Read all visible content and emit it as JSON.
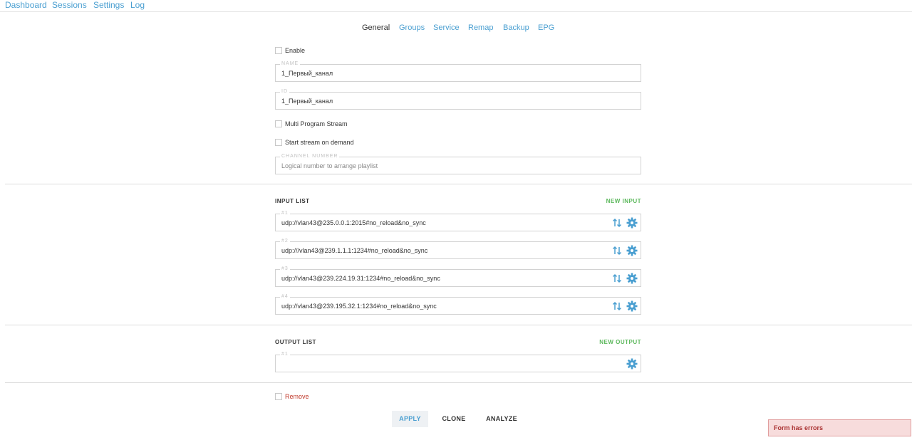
{
  "topnav": {
    "items": [
      "Dashboard",
      "Sessions",
      "Settings",
      "Log"
    ]
  },
  "tabs": {
    "items": [
      "General",
      "Groups",
      "Service",
      "Remap",
      "Backup",
      "EPG"
    ],
    "active": "General"
  },
  "general": {
    "enable_label": "Enable",
    "name_legend": "NAME",
    "name_value": "1_Первый_канал",
    "id_legend": "ID",
    "id_value": "1_Первый_канал",
    "mps_label": "Multi Program Stream",
    "on_demand_label": "Start stream on demand",
    "channel_number_legend": "CHANNEL NUMBER",
    "channel_number_placeholder": "Logical number to arrange playlist"
  },
  "input_list": {
    "title": "INPUT LIST",
    "action": "NEW INPUT",
    "items": [
      {
        "legend": "#1",
        "value": "udp://vlan43@235.0.0.1:2015#no_reload&no_sync"
      },
      {
        "legend": "#2",
        "value": "udp:///vlan43@239.1.1.1:1234#no_reload&no_sync"
      },
      {
        "legend": "#3",
        "value": "udp://vlan43@239.224.19.31:1234#no_reload&no_sync"
      },
      {
        "legend": "#4",
        "value": "udp://vlan43@239.195.32.1:1234#no_reload&no_sync"
      }
    ]
  },
  "output_list": {
    "title": "OUTPUT LIST",
    "action": "NEW OUTPUT",
    "items": [
      {
        "legend": "#1",
        "value": ""
      }
    ]
  },
  "remove_label": "Remove",
  "buttons": {
    "apply": "APPLY",
    "clone": "CLONE",
    "analyze": "ANALYZE"
  },
  "toast": "Form has errors",
  "colors": {
    "link": "#4a9fd1",
    "success": "#5cb85c",
    "danger": "#c0392b",
    "icon": "#4a9fd1"
  },
  "icons": {
    "sort": "sort-arrows-icon",
    "settings": "gear-icon"
  }
}
